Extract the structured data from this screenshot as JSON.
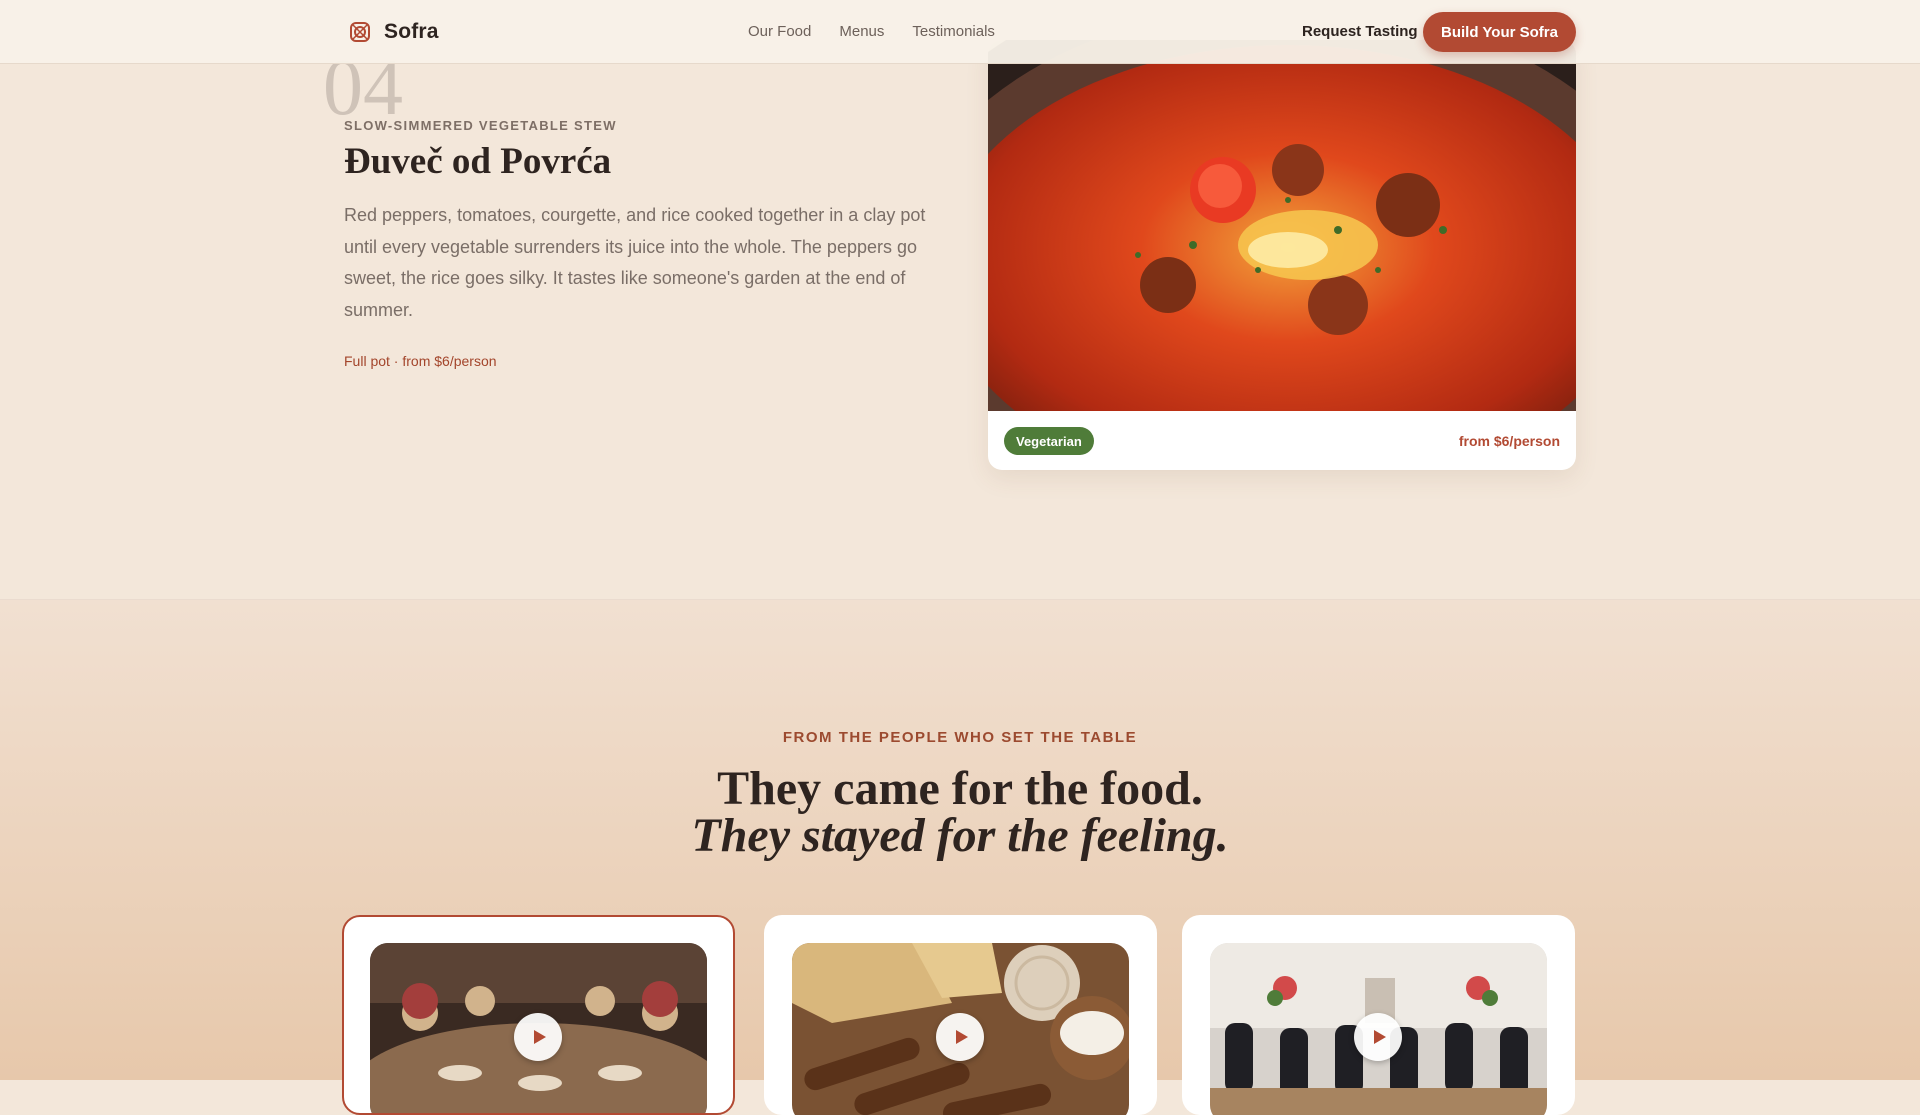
{
  "header": {
    "brand": "Sofra",
    "nav": [
      "Our Food",
      "Menus",
      "Testimonials"
    ],
    "request_label": "Request Tasting",
    "cta_label": "Build Your Sofra"
  },
  "dish": {
    "number": "04",
    "kicker": "SLOW-SIMMERED VEGETABLE STEW",
    "title": "Đuveč od Povrća",
    "description": "Red peppers, tomatoes, courgette, and rice cooked together in a clay pot until every vegetable surrenders its juice into the whole. The peppers go sweet, the rice goes silky. It tastes like someone's garden at the end of summer.",
    "note": "Full pot · from $6/person",
    "badge": "Vegetarian",
    "price": "from $6/person"
  },
  "testimonials": {
    "kicker": "FROM THE PEOPLE WHO SET THE TABLE",
    "headline_line1": "They came for the food.",
    "headline_line2": "They stayed for the feeling.",
    "videos": [
      {
        "icon": "play-icon"
      },
      {
        "icon": "play-icon"
      },
      {
        "icon": "play-icon"
      }
    ]
  },
  "colors": {
    "accent": "#b24a33",
    "vegetarian_badge": "#4f7c39",
    "page_background": "#f3e7da"
  }
}
